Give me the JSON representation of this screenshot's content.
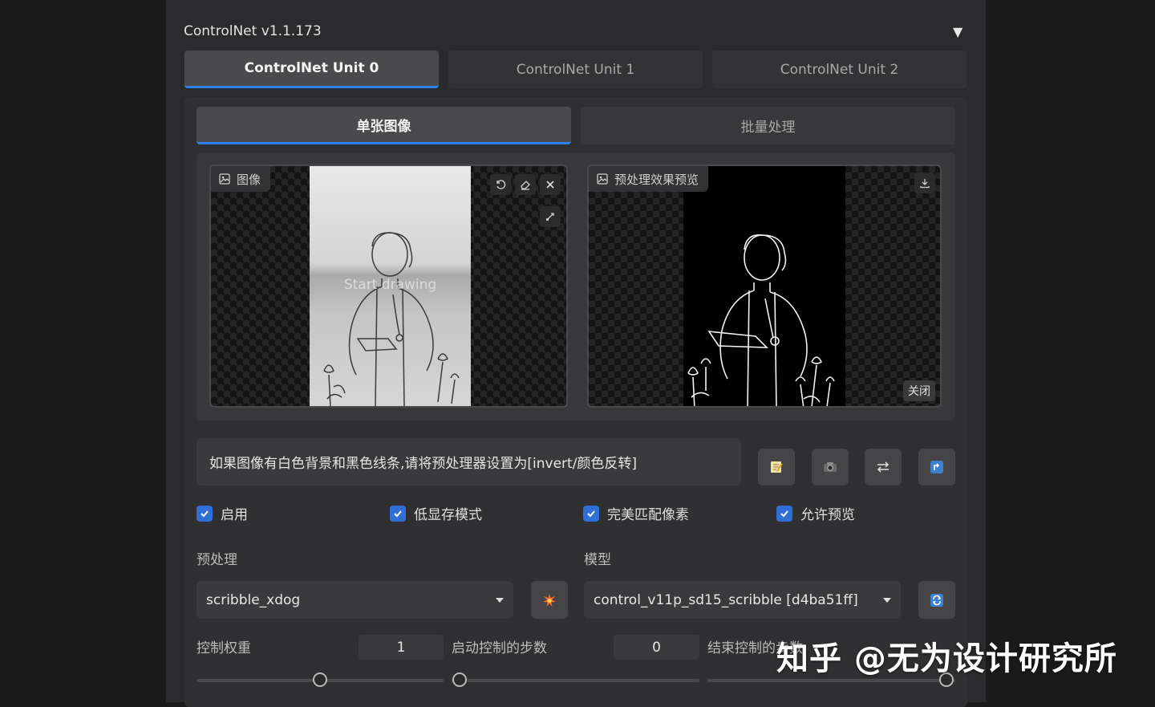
{
  "header": {
    "title": "ControlNet v1.1.173",
    "collapse_glyph": "▼"
  },
  "unit_tabs": [
    {
      "label": "ControlNet Unit 0",
      "active": true
    },
    {
      "label": "ControlNet Unit 1",
      "active": false
    },
    {
      "label": "ControlNet Unit 2",
      "active": false
    }
  ],
  "mode_tabs": [
    {
      "label": "单张图像",
      "active": true
    },
    {
      "label": "批量处理",
      "active": false
    }
  ],
  "image_panel": {
    "label": "图像",
    "overlay_text": "Start drawing",
    "label_icon": "image-icon"
  },
  "preview_panel": {
    "label": "预处理效果预览",
    "close_label": "关闭",
    "label_icon": "image-icon"
  },
  "hint": "如果图像有白色背景和黑色线条,请将预处理器设置为[invert/颜色反转]",
  "checkboxes": [
    {
      "label": "启用",
      "checked": true
    },
    {
      "label": "低显存模式",
      "checked": true
    },
    {
      "label": "完美匹配像素",
      "checked": true
    },
    {
      "label": "允许预览",
      "checked": true
    }
  ],
  "preprocessor": {
    "label": "预处理",
    "value": "scribble_xdog"
  },
  "model": {
    "label": "模型",
    "value": "control_v11p_sd15_scribble [d4ba51ff]"
  },
  "sliders": {
    "control_weight": {
      "label": "控制权重",
      "value": "1"
    },
    "start_step": {
      "label": "启动控制的步数",
      "value": "0"
    },
    "end_step": {
      "label": "结束控制的步数"
    }
  },
  "watermark": "知乎 @无为设计研究所",
  "colors": {
    "accent": "#2f80ed",
    "checkbox": "#2f6fd6",
    "panel": "#2b2b2d"
  }
}
